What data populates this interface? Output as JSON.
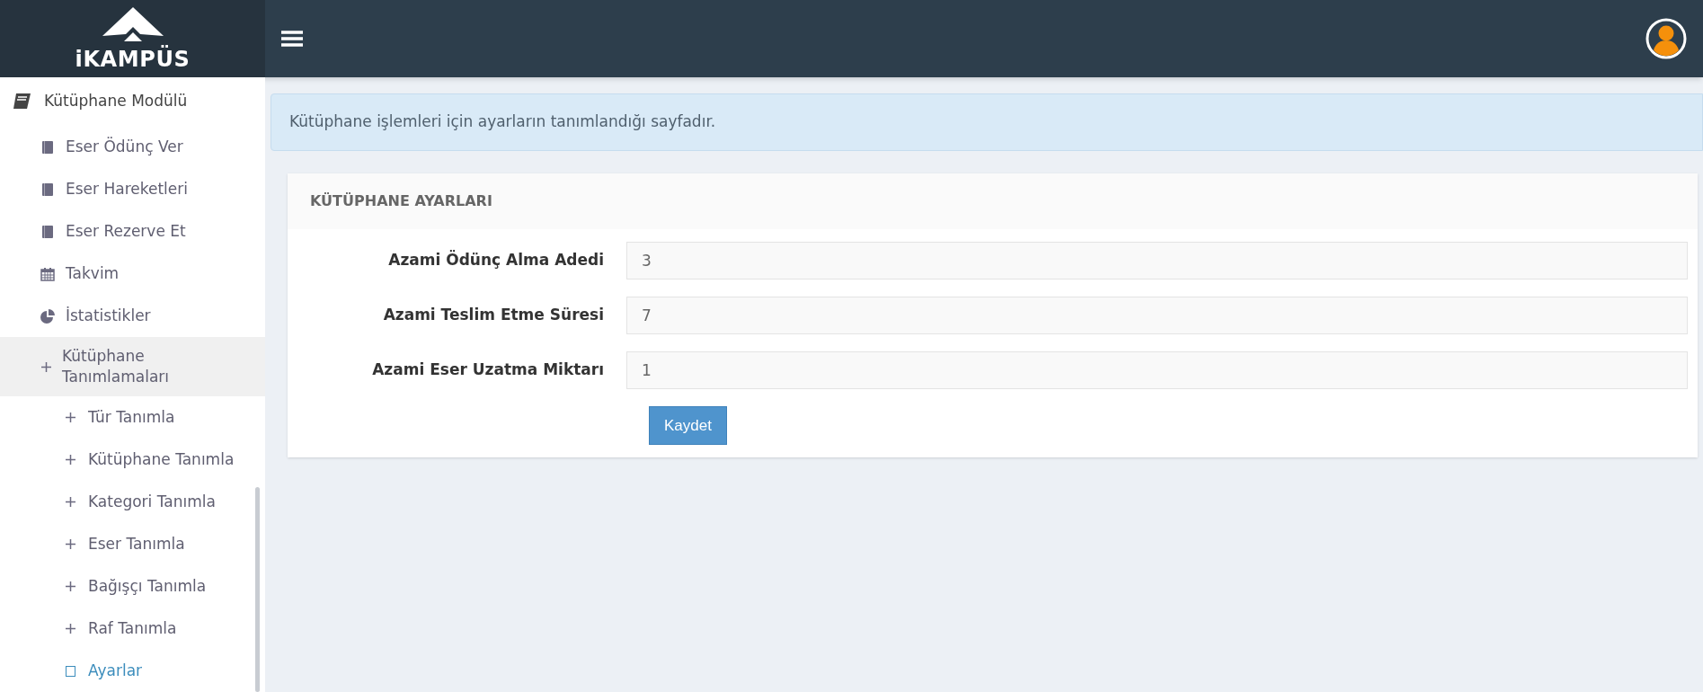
{
  "brand": {
    "name": "iKAMPÜS"
  },
  "sidebar": {
    "module": {
      "label": "Kütüphane Modülü"
    },
    "items": [
      {
        "kind": "book",
        "label": "Eser Ödünç Ver",
        "selected": false
      },
      {
        "kind": "book",
        "label": "Eser Hareketleri",
        "selected": false
      },
      {
        "kind": "book",
        "label": "Eser Rezerve Et",
        "selected": false
      },
      {
        "kind": "calendar",
        "label": "Takvim",
        "selected": false
      },
      {
        "kind": "chart",
        "label": "İstatistikler",
        "selected": false
      },
      {
        "kind": "group",
        "label": "Kütüphane Tanımlamaları",
        "expanded": true,
        "children": [
          {
            "kind": "plus",
            "label": "Tür Tanımla",
            "selected": false
          },
          {
            "kind": "plus",
            "label": "Kütüphane Tanımla",
            "selected": false
          },
          {
            "kind": "plus",
            "label": "Kategori Tanımla",
            "selected": false
          },
          {
            "kind": "plus",
            "label": "Eser Tanımla",
            "selected": false
          },
          {
            "kind": "plus",
            "label": "Bağışçı Tanımla",
            "selected": false
          },
          {
            "kind": "plus",
            "label": "Raf Tanımla",
            "selected": false
          },
          {
            "kind": "square",
            "label": "Ayarlar",
            "selected": true
          }
        ]
      }
    ]
  },
  "alert": "Kütüphane işlemleri için ayarların tanımlandığı sayfadır.",
  "panel": {
    "title": "KÜTÜPHANE AYARLARI",
    "fields": [
      {
        "label": "Azami Ödünç Alma Adedi",
        "value": "3"
      },
      {
        "label": "Azami Teslim Etme Süresi",
        "value": "7"
      },
      {
        "label": "Azami Eser Uzatma Miktarı",
        "value": "1"
      }
    ],
    "button": "Kaydet"
  }
}
